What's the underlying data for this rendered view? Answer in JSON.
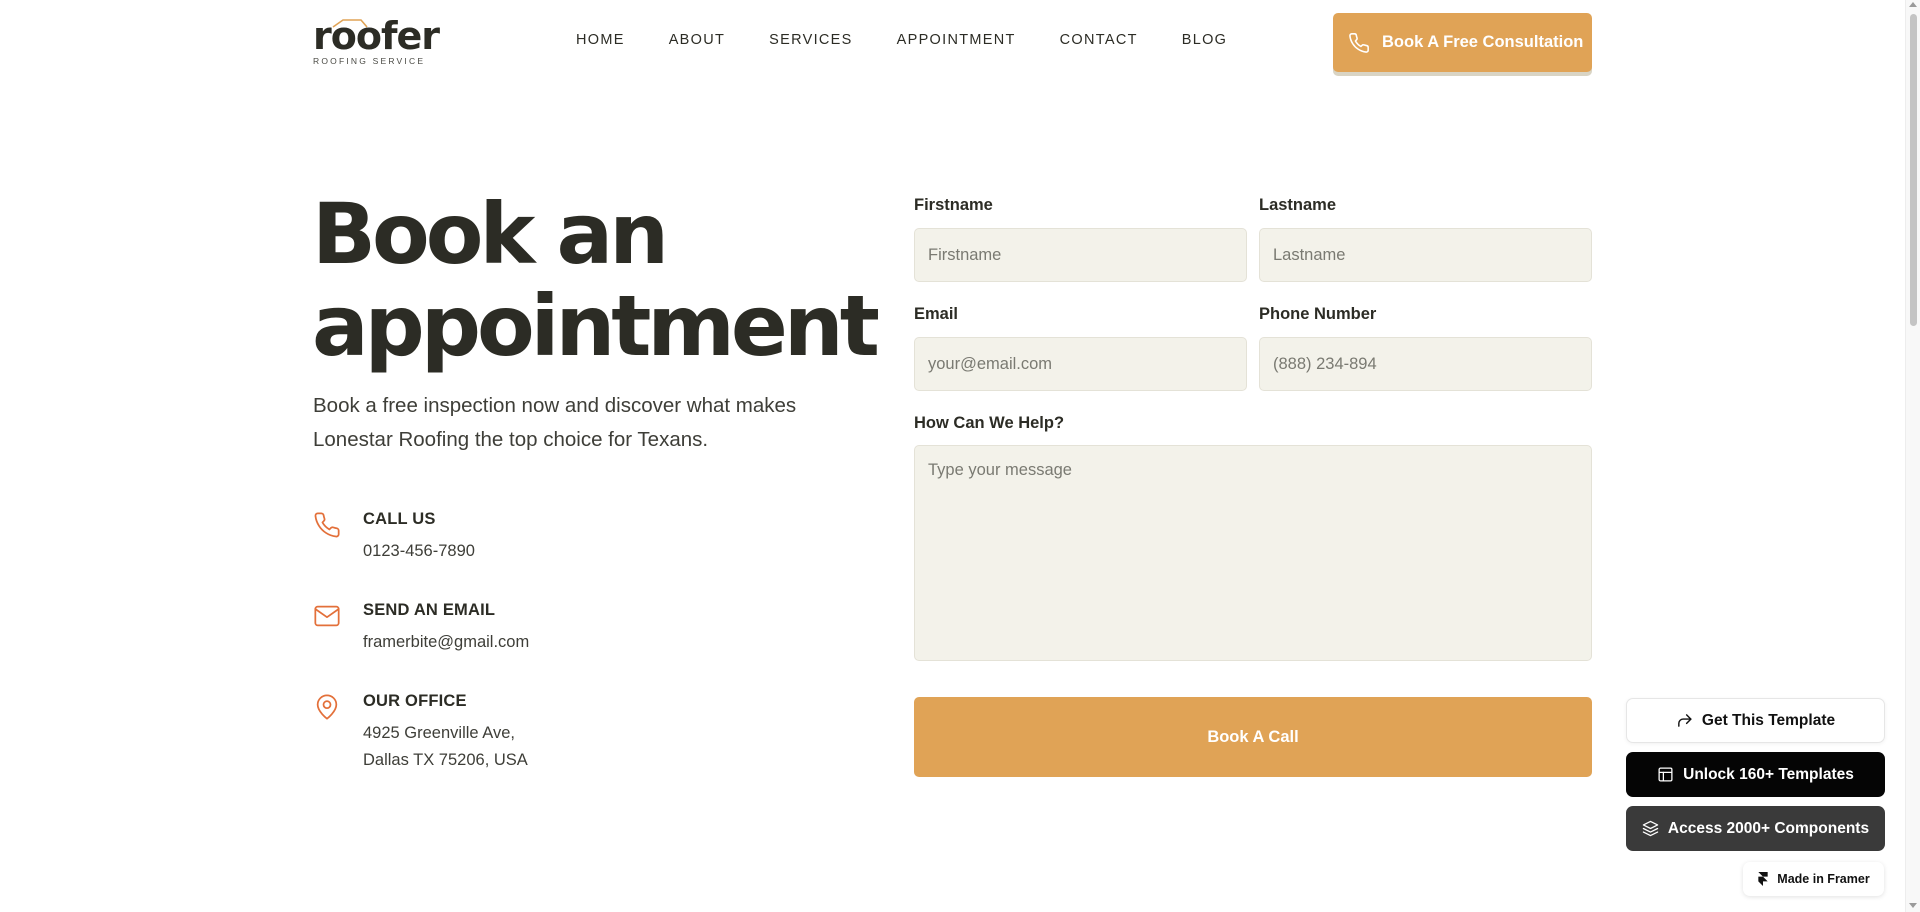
{
  "header": {
    "logo_text": "roofer",
    "logo_subtext": "ROOFING SERVICE",
    "nav": [
      "HOME",
      "ABOUT",
      "SERVICES",
      "APPOINTMENT",
      "CONTACT",
      "BLOG"
    ],
    "cta_label": "Book A Free Consultation"
  },
  "hero": {
    "title_line1": "Book an",
    "title_line2": "appointment",
    "subtitle": "Book a free inspection now and discover what makes Lonestar Roofing the top choice for Texans."
  },
  "contact": {
    "call": {
      "title": "CALL US",
      "value": "0123-456-7890",
      "icon": "phone-icon"
    },
    "email": {
      "title": "SEND AN EMAIL",
      "value": "framerbite@gmail.com",
      "icon": "mail-icon"
    },
    "office": {
      "title": "OUR OFFICE",
      "line1": "4925 Greenville Ave,",
      "line2": "Dallas TX 75206, USA",
      "icon": "map-pin-icon"
    }
  },
  "form": {
    "firstname": {
      "label": "Firstname",
      "placeholder": "Firstname",
      "value": ""
    },
    "lastname": {
      "label": "Lastname",
      "placeholder": "Lastname",
      "value": ""
    },
    "email": {
      "label": "Email",
      "placeholder": "your@email.com",
      "value": ""
    },
    "phone": {
      "label": "Phone Number",
      "placeholder": "(888) 234-894",
      "value": ""
    },
    "message": {
      "label": "How Can We Help?",
      "placeholder": "Type your message",
      "value": ""
    },
    "submit_label": "Book A Call"
  },
  "widgets": {
    "get_template": "Get This Template",
    "unlock_templates": "Unlock 160+ Templates",
    "access_components": "Access 2000+ Components",
    "made_in_framer": "Made in Framer"
  },
  "colors": {
    "accent": "#e0a356",
    "icon_orange": "#e3703a",
    "text_dark": "#2c2c25",
    "input_bg": "#f3f2ea"
  }
}
